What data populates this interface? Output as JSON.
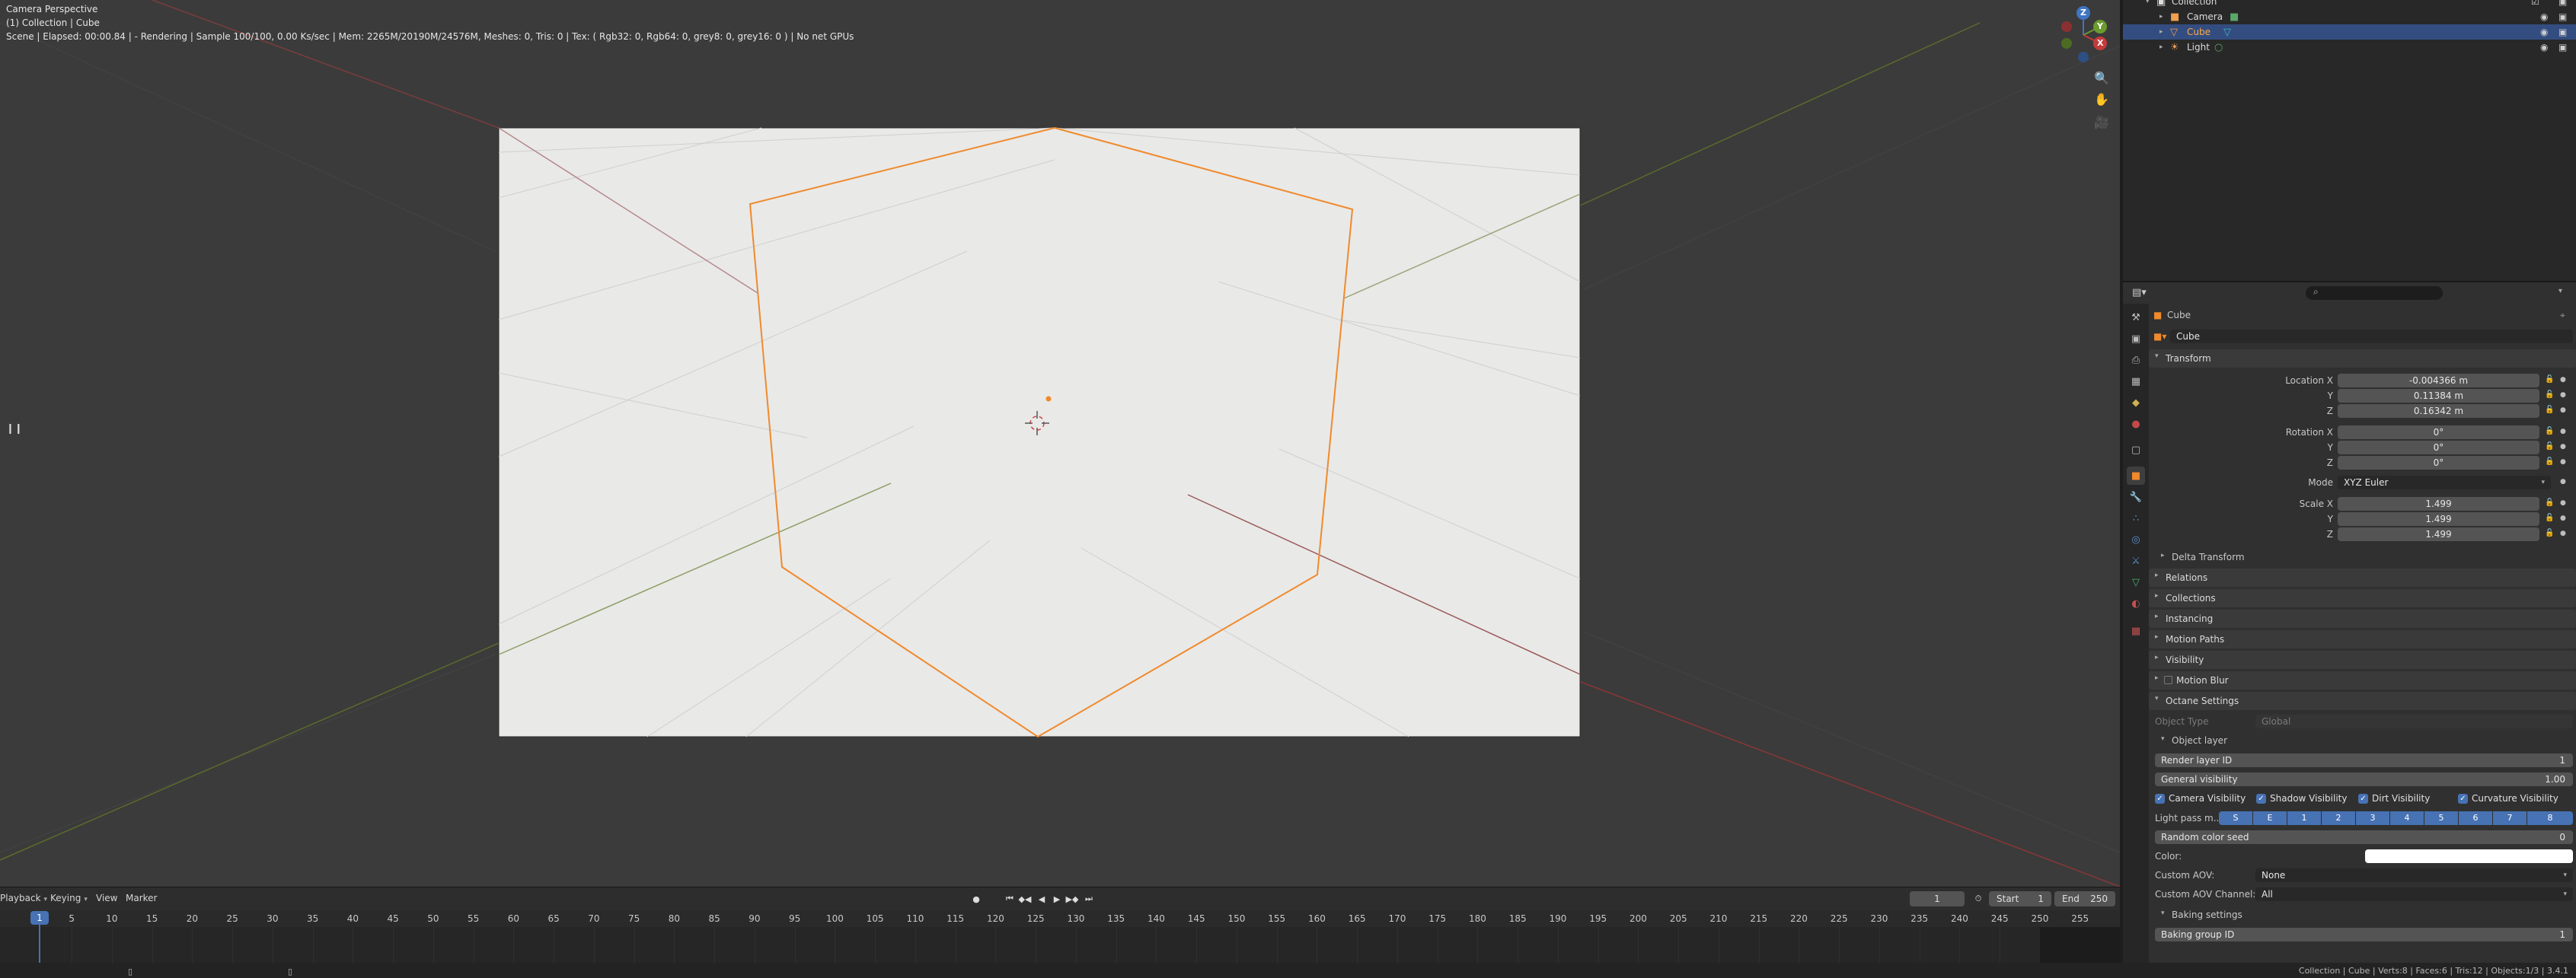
{
  "viewport": {
    "hud_title": "Camera Perspective",
    "hud_collection": "(1) Collection | Cube",
    "hud_render": "Scene | Elapsed: 00:00.84 | - Rendering | Sample 100/100, 0.00 Ks/sec | Mem: 2265M/20190M/24576M, Meshes: 0, Tris: 0 | Tex: ( Rgb32: 0, Rgb64: 0, grey8: 0, grey16: 0 ) | No net GPUs",
    "gizmo": {
      "z_label": "Z",
      "y_label": "Y",
      "x_label": "X"
    },
    "nav_icons": [
      "zoom-icon",
      "hand-pan-icon",
      "camera-view-icon"
    ]
  },
  "timeline": {
    "menus": [
      "Playback",
      "Keying",
      "View",
      "Marker"
    ],
    "current_frame": "1",
    "start_label": "Start",
    "start_value": "1",
    "end_label": "End",
    "end_value": "250",
    "cursor_frame": "1",
    "ruler_ticks": [
      "5",
      "10",
      "15",
      "20",
      "25",
      "30",
      "35",
      "40",
      "45",
      "50",
      "55",
      "60",
      "65",
      "70",
      "75",
      "80",
      "85",
      "90",
      "95",
      "100",
      "105",
      "110",
      "115",
      "120",
      "125",
      "130",
      "135",
      "140",
      "145",
      "150",
      "155",
      "160",
      "165",
      "170",
      "175",
      "180",
      "185",
      "190",
      "195",
      "200",
      "205",
      "210",
      "215",
      "220",
      "225",
      "230",
      "235",
      "240",
      "245",
      "250",
      "255"
    ]
  },
  "outliner": {
    "rows": [
      {
        "name": "Collection",
        "icon": "collection-icon",
        "selected": false
      },
      {
        "name": "Camera",
        "icon": "camera-object-icon",
        "selected": false
      },
      {
        "name": "Cube",
        "icon": "mesh-object-icon",
        "selected": true
      },
      {
        "name": "Light",
        "icon": "light-object-icon",
        "selected": false
      }
    ]
  },
  "properties": {
    "object_name": "Cube",
    "datablock_name": "Cube",
    "transform": {
      "header": "Transform",
      "location_label": "Location X",
      "location": [
        "-0.004366 m",
        "0.11384 m",
        "0.16342 m"
      ],
      "rotation_label": "Rotation X",
      "rotation": [
        "0°",
        "0°",
        "0°"
      ],
      "mode_label": "Mode",
      "mode_value": "XYZ Euler",
      "scale_label": "Scale X",
      "scale": [
        "1.499",
        "1.499",
        "1.499"
      ],
      "y_label": "Y",
      "z_label": "Z",
      "delta": "Delta Transform"
    },
    "panels": [
      "Relations",
      "Collections",
      "Instancing",
      "Motion Paths",
      "Visibility",
      "Motion Blur"
    ],
    "octane": {
      "header": "Octane Settings",
      "object_type_label": "Object Type",
      "object_type_value": "Global",
      "object_layer": "Object layer",
      "render_layer_label": "Render layer ID",
      "render_layer_value": "1",
      "general_vis_label": "General visibility",
      "general_vis_value": "1.00",
      "checks": [
        "Camera Visibility",
        "Shadow Visibility",
        "Dirt Visibility",
        "Curvature Visibility"
      ],
      "light_pass_label": "Light pass m...",
      "light_pass_buttons": [
        "S",
        "E",
        "1",
        "2",
        "3",
        "4",
        "5",
        "6",
        "7",
        "8"
      ],
      "random_seed_label": "Random color seed",
      "random_seed_value": "0",
      "color_label": "Color:",
      "custom_aov_label": "Custom AOV:",
      "custom_aov_value": "None",
      "custom_aov_channel_label": "Custom AOV Channel:",
      "custom_aov_channel_value": "All",
      "baking_settings": "Baking settings",
      "baking_group_label": "Baking group ID",
      "baking_group_value": "1"
    }
  },
  "statusbar": {
    "text": "Collection | Cube | Verts:8 | Faces:6 | Tris:12 | Objects:1/3 | 3.4.1"
  },
  "colors": {
    "selection_orange": "#f08a2c",
    "accent_blue": "#4772b3",
    "x_axis": "#b34a4a",
    "y_axis": "#7a8f3a"
  }
}
